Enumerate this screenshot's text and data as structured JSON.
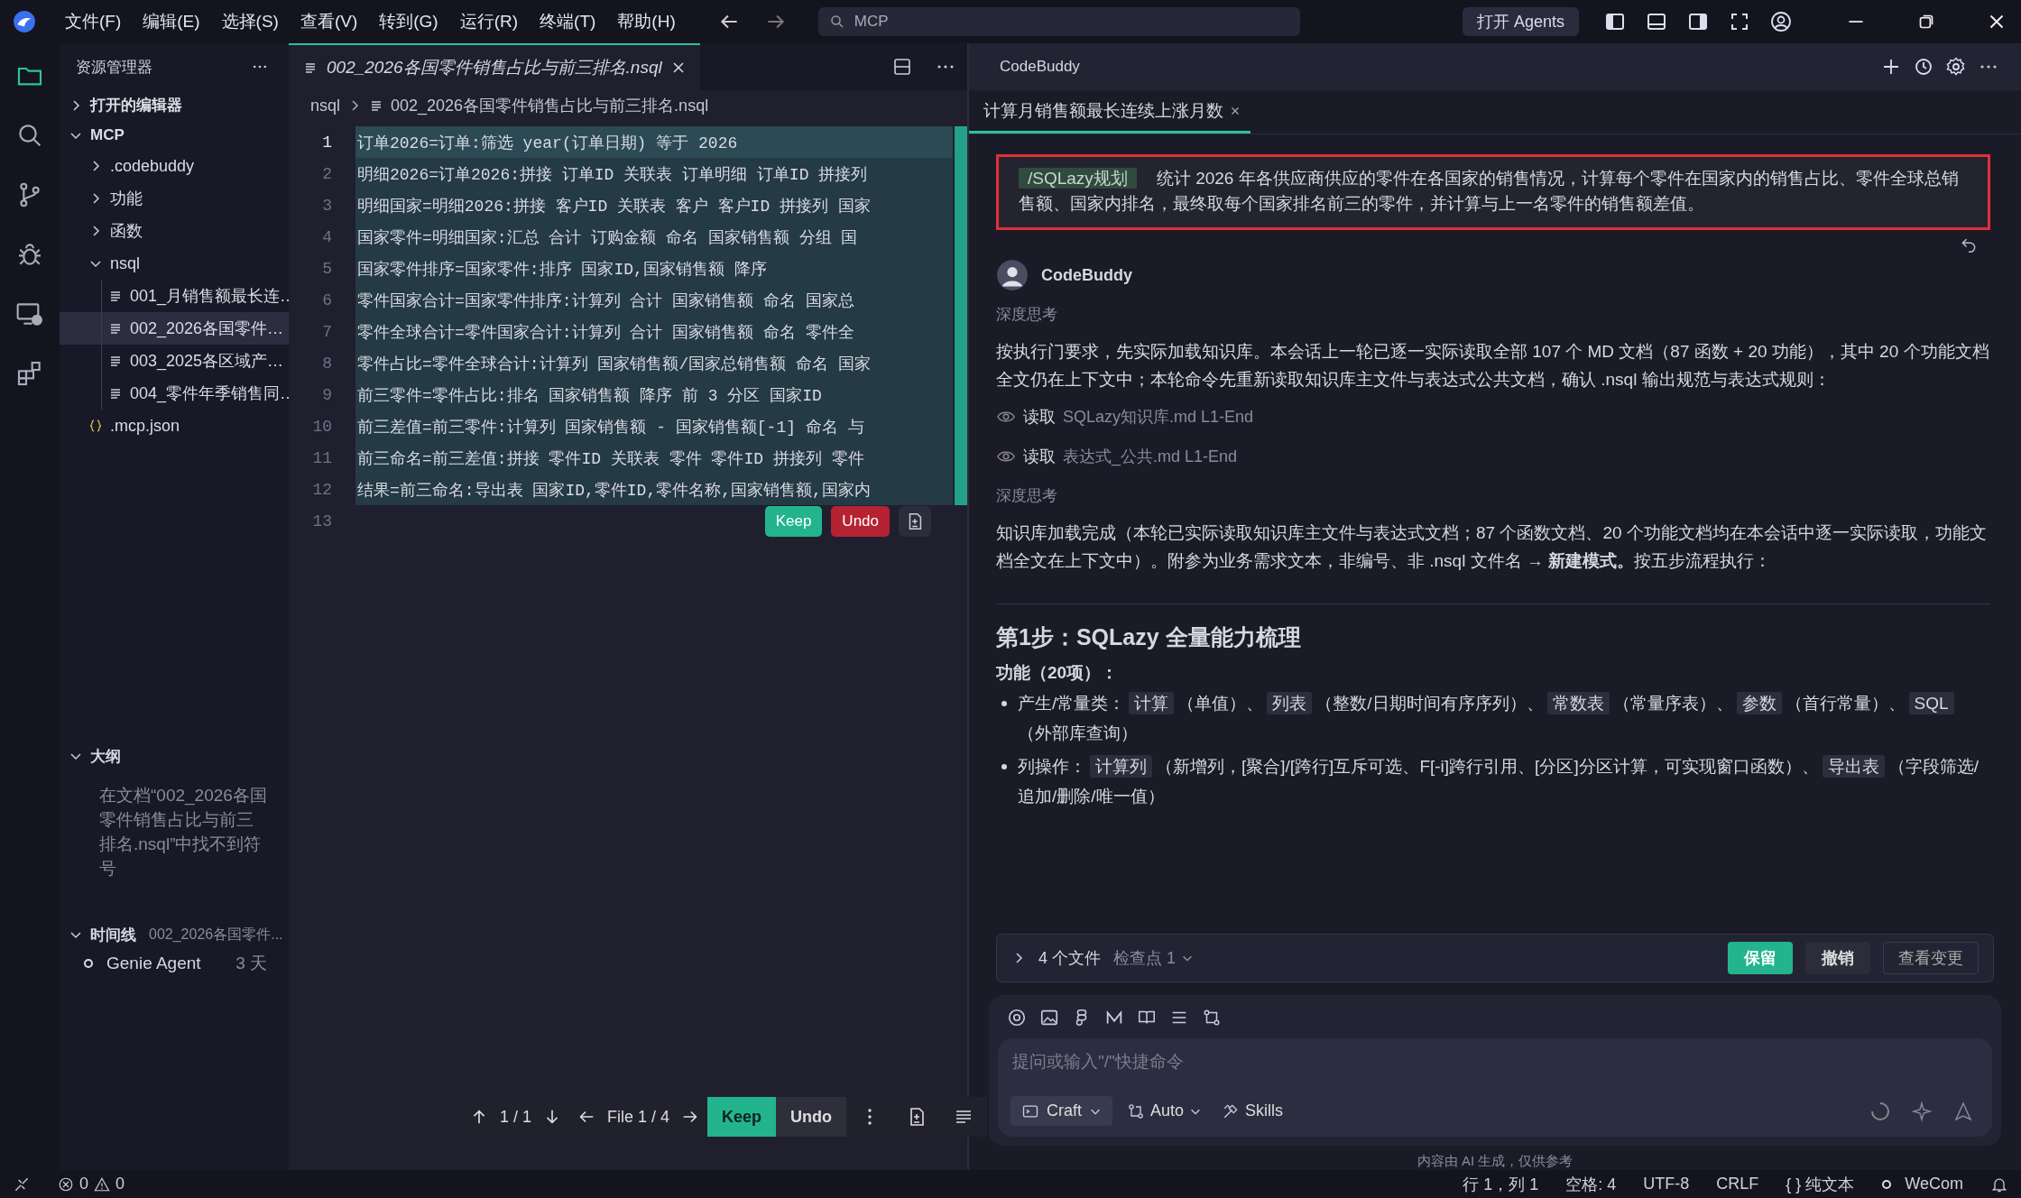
{
  "menu": [
    "文件(F)",
    "编辑(E)",
    "选择(S)",
    "查看(V)",
    "转到(G)",
    "运行(R)",
    "终端(T)",
    "帮助(H)"
  ],
  "search": {
    "value": "MCP"
  },
  "agents_button": "打开 Agents",
  "activity_bar": [
    {
      "selected": true
    },
    {
      "selected": false
    },
    {
      "selected": false
    },
    {
      "selected": false
    },
    {
      "selected": false
    },
    {
      "selected": false
    }
  ],
  "explorer": {
    "title": "资源管理器",
    "tree": [
      {
        "kind": "section",
        "label": "打开的编辑器",
        "expanded": false
      },
      {
        "kind": "section",
        "label": "MCP",
        "expanded": true,
        "children": [
          {
            "kind": "folder",
            "label": ".codebuddy",
            "expanded": false,
            "selected": false
          },
          {
            "kind": "folder",
            "label": "功能",
            "expanded": false,
            "selected": false
          },
          {
            "kind": "folder",
            "label": "函数",
            "expanded": false,
            "selected": false
          },
          {
            "kind": "folder",
            "label": "nsql",
            "expanded": true,
            "selected": false,
            "children": [
              {
                "kind": "file",
                "label": "001_月销售额最长连…",
                "selected": false
              },
              {
                "kind": "file",
                "label": "002_2026各国零件…",
                "selected": true
              },
              {
                "kind": "file",
                "label": "003_2025各区域产…",
                "selected": false
              },
              {
                "kind": "file",
                "label": "004_零件年季销售同…",
                "selected": false
              }
            ]
          },
          {
            "kind": "json",
            "label": ".mcp.json",
            "selected": false
          }
        ]
      }
    ]
  },
  "outline": {
    "title": "大纲",
    "expanded": true,
    "message": "在文档“002_2026各国零件销售占比与前三排名.nsql”中找不到符号"
  },
  "timeline": {
    "title": "时间线",
    "file": "002_2026各国零件...",
    "expanded": true,
    "items": [
      {
        "label": "Genie Agent",
        "time": "3 天"
      }
    ]
  },
  "editor": {
    "tab": {
      "label": "002_2026各国零件销售占比与前三排名.nsql",
      "selected": true
    },
    "breadcrumb": [
      "nsql",
      "002_2026各国零件销售占比与前三排名.nsql"
    ],
    "lines": [
      {
        "number": "1",
        "text": "订单2026=订单:筛选 year(订单日期) 等于 2026",
        "current": true,
        "added": true
      },
      {
        "number": "2",
        "text": "明细2026=订单2026:拼接 订单ID 关联表 订单明细 订单ID 拼接列",
        "current": false,
        "added": true
      },
      {
        "number": "3",
        "text": "明细国家=明细2026:拼接 客户ID 关联表 客户 客户ID 拼接列 国家",
        "current": false,
        "added": true
      },
      {
        "number": "4",
        "text": "国家零件=明细国家:汇总 合计 订购金额 命名 国家销售额 分组 国",
        "current": false,
        "added": true
      },
      {
        "number": "5",
        "text": "国家零件排序=国家零件:排序 国家ID,国家销售额 降序",
        "current": false,
        "added": true
      },
      {
        "number": "6",
        "text": "零件国家合计=国家零件排序:计算列 合计 国家销售额 命名 国家总",
        "current": false,
        "added": true
      },
      {
        "number": "7",
        "text": "零件全球合计=零件国家合计:计算列 合计 国家销售额 命名 零件全",
        "current": false,
        "added": true
      },
      {
        "number": "8",
        "text": "零件占比=零件全球合计:计算列 国家销售额/国家总销售额 命名 国家",
        "current": false,
        "added": true
      },
      {
        "number": "9",
        "text": "前三零件=零件占比:排名 国家销售额 降序 前 3 分区 国家ID",
        "current": false,
        "added": true
      },
      {
        "number": "10",
        "text": "前三差值=前三零件:计算列 国家销售额 - 国家销售额[-1] 命名 与",
        "current": false,
        "added": true
      },
      {
        "number": "11",
        "text": "前三命名=前三差值:拼接 零件ID 关联表 零件 零件ID 拼接列 零件",
        "current": false,
        "added": true
      },
      {
        "number": "12",
        "text": "结果=前三命名:导出表 国家ID,零件ID,零件名称,国家销售额,国家内",
        "current": false,
        "added": true
      },
      {
        "number": "13",
        "current": false
      }
    ],
    "inline_actions": {
      "keep": "Keep",
      "undo": "Undo"
    },
    "diff_bar": {
      "change": "1 / 1",
      "file": "File 1 / 4",
      "keep": "Keep",
      "undo": "Undo"
    }
  },
  "chat": {
    "title": "CodeBuddy",
    "tabs": [
      {
        "label": "计算月销售额最长连续上涨月数",
        "selected": true
      }
    ],
    "user_message": {
      "command": "/SQLazy规划",
      "text": "统计 2026 年各供应商供应的零件在各国家的销售情况，计算每个零件在国家内的销售占比、零件全球总销售额、国家内排名，最终取每个国家排名前三的零件，并计算与上一名零件的销售额差值。"
    },
    "reply": {
      "author": "CodeBuddy",
      "blocks": [
        {
          "kind": "thinking",
          "text": "深度思考"
        },
        {
          "kind": "paragraph",
          "text": "按执行门要求，先实际加载知识库。本会话上一轮已逐一实际读取全部 107 个 MD 文档（87 函数 + 20 功能），其中 20 个功能文档全文仍在上下文中；本轮命令先重新读取知识库主文件与表达式公共文档，确认 .nsql 输出规范与表达式规则："
        },
        {
          "kind": "read",
          "label": "读取",
          "file": "SQLazy知识库.md L1-End"
        },
        {
          "kind": "read",
          "label": "读取",
          "file": "表达式_公共.md L1-End"
        },
        {
          "kind": "thinking",
          "text": "深度思考"
        },
        {
          "kind": "paragraph",
          "text": "知识库加载完成（本轮已实际读取知识库主文件与表达式文档；87 个函数文档、20 个功能文档均在本会话中逐一实际读取，功能文档全文在上下文中）。附参为业务需求文本，非编号、非 .nsql 文件名 → **新建模式。**按五步流程执行："
        },
        {
          "kind": "rule"
        },
        {
          "kind": "heading",
          "text": "第1步：SQLazy 全量能力梳理"
        },
        {
          "kind": "subheading",
          "text": "功能（20项）："
        },
        {
          "kind": "bullet",
          "parts": [
            {
              "kind": "text",
              "text": "产生/常量类："
            },
            {
              "kind": "code",
              "text": "计算"
            },
            {
              "kind": "text",
              "text": "（单值）、"
            },
            {
              "kind": "code",
              "text": "列表"
            },
            {
              "kind": "text",
              "text": "（整数/日期时间有序序列）、"
            },
            {
              "kind": "code",
              "text": "常数表"
            },
            {
              "kind": "text",
              "text": "（常量序表）、"
            },
            {
              "kind": "code",
              "text": "参数"
            },
            {
              "kind": "text",
              "text": "（首行常量）、"
            },
            {
              "kind": "code",
              "text": "SQL"
            },
            {
              "kind": "text",
              "text": "（外部库查询）"
            }
          ]
        },
        {
          "kind": "bullet",
          "parts": [
            {
              "kind": "text",
              "text": "列操作："
            },
            {
              "kind": "code",
              "text": "计算列"
            },
            {
              "kind": "text",
              "text": "（新增列，[聚合]/[跨行]互斥可选、F[-i]跨行引用、[分区]分区计算，可实现窗口函数）、"
            },
            {
              "kind": "code",
              "text": "导出表"
            },
            {
              "kind": "text",
              "text": "（字段筛选/追加/删除/唯一值）"
            }
          ]
        }
      ]
    },
    "changes": {
      "expanded": false,
      "files": "4 个文件",
      "checkpoint": "检查点 1",
      "keep": "保留",
      "undo": "撤销",
      "review": "查看变更"
    },
    "input": {
      "placeholder": "提问或输入\"/\"快捷命令",
      "mode": "Craft",
      "model": "Auto",
      "skills": "Skills"
    },
    "footer": "内容由 AI 生成，仅供参考"
  },
  "status_bar": {
    "errors": "0",
    "warnings": "0",
    "items": [
      {
        "kind": "plain",
        "text": "行 1，列 1"
      },
      {
        "kind": "plain",
        "text": "空格: 4"
      },
      {
        "kind": "plain",
        "text": "UTF-8"
      },
      {
        "kind": "plain",
        "text": "CRLF"
      },
      {
        "kind": "plain",
        "text": "{ } 纯文本"
      },
      {
        "kind": "status",
        "text": "WeCom"
      }
    ]
  }
}
